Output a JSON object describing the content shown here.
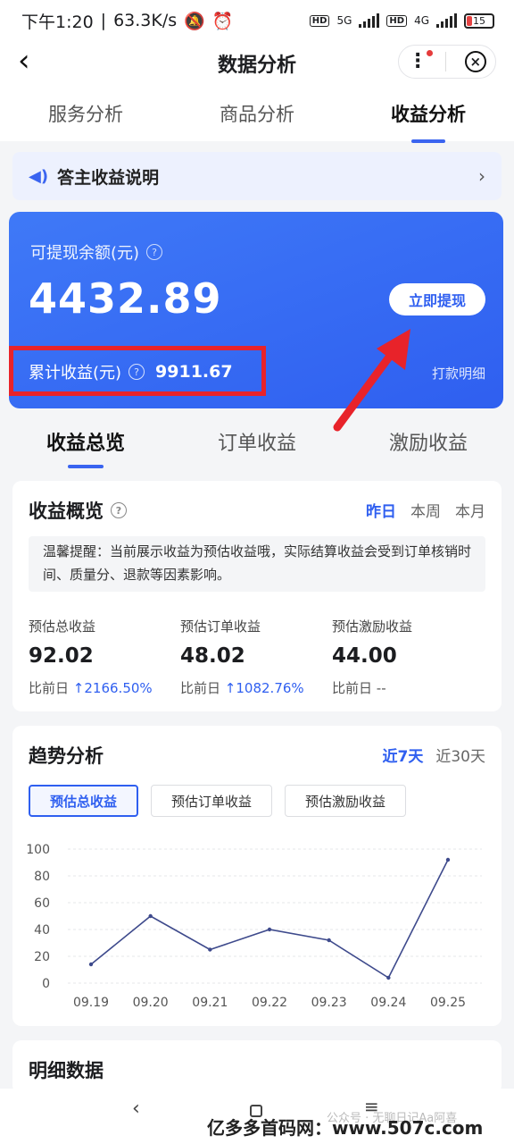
{
  "status": {
    "time": "下午1:20",
    "speed": "63.3K/s",
    "net1": "5G",
    "net2": "4G",
    "hd": "HD",
    "battery": "15"
  },
  "nav": {
    "title": "数据分析",
    "back_icon": "‹",
    "more_icon": "⋮",
    "close_icon": "×"
  },
  "tabs": [
    {
      "label": "服务分析"
    },
    {
      "label": "商品分析"
    },
    {
      "label": "收益分析"
    }
  ],
  "notice": {
    "text": "答主收益说明",
    "chevron": "›"
  },
  "balance": {
    "label": "可提现余额(元)",
    "amount": "4432.89",
    "withdraw": "立即提现",
    "cumulative_label": "累计收益(元)",
    "cumulative_value": "9911.67",
    "detail_link": "打款明细"
  },
  "subtabs": [
    {
      "label": "收益总览"
    },
    {
      "label": "订单收益"
    },
    {
      "label": "激励收益"
    }
  ],
  "overview": {
    "title": "收益概览",
    "periods": [
      "昨日",
      "本周",
      "本月"
    ],
    "tip": "温馨提醒：当前展示收益为预估收益哦，实际结算收益会受到订单核销时间、质量分、退款等因素影响。",
    "stats": [
      {
        "label": "预估总收益",
        "value": "92.02",
        "cmp": "比前日",
        "arrow": "↑",
        "change": "2166.50%"
      },
      {
        "label": "预估订单收益",
        "value": "48.02",
        "cmp": "比前日",
        "arrow": "↑",
        "change": "1082.76%"
      },
      {
        "label": "预估激励收益",
        "value": "44.00",
        "cmp": "比前日",
        "arrow": "",
        "change": "--"
      }
    ]
  },
  "trend": {
    "title": "趋势分析",
    "ranges": [
      "近7天",
      "近30天"
    ],
    "metrics": [
      "预估总收益",
      "预估订单收益",
      "预估激励收益"
    ]
  },
  "chart_data": {
    "type": "line",
    "x": [
      "09.19",
      "09.20",
      "09.21",
      "09.22",
      "09.23",
      "09.24",
      "09.25"
    ],
    "series": [
      {
        "values": [
          14,
          50,
          25,
          40,
          32,
          4,
          92
        ]
      }
    ],
    "yticks": [
      0,
      20,
      40,
      60,
      80,
      100
    ],
    "ylim": [
      0,
      100
    ],
    "grid": true,
    "line_color": "#3e4a8c"
  },
  "detail": {
    "title": "明细数据"
  },
  "bottom": {
    "watermark": "亿多多首码网：www.507c.com",
    "faint_text": "公众号 · 无聊日记Aa阿喜"
  },
  "colors": {
    "accent": "#2f5ff0",
    "highlight": "#e8232a"
  }
}
